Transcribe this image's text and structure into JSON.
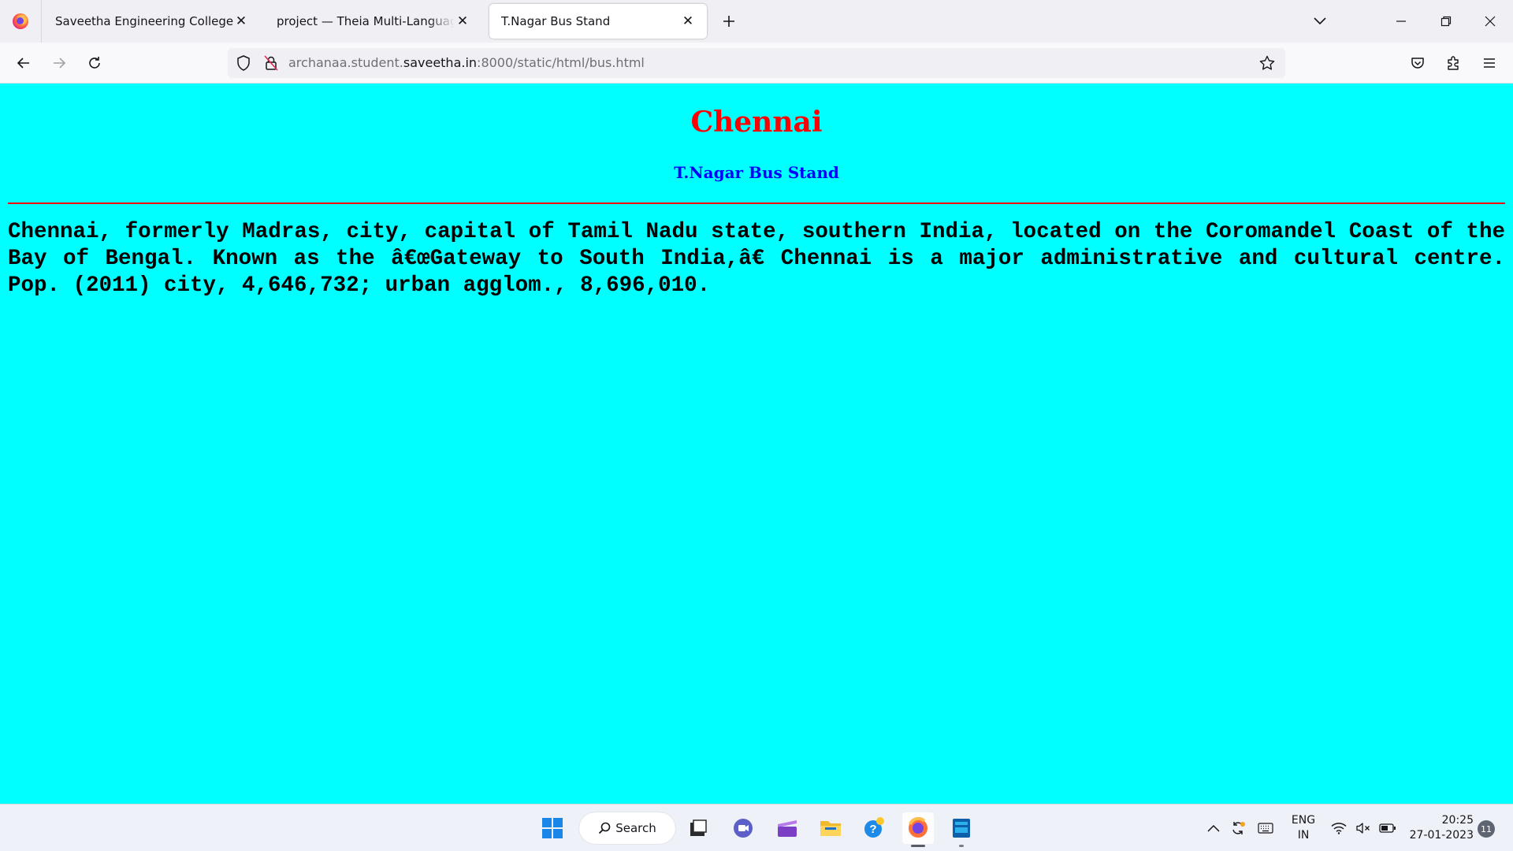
{
  "browser": {
    "tabs": [
      {
        "title": "Saveetha Engineering College",
        "active": false
      },
      {
        "title": "project — Theia Multi-Language Explorer",
        "active": false
      },
      {
        "title": "T.Nagar Bus Stand",
        "active": true
      }
    ],
    "new_tab_icon": "plus-icon",
    "url": {
      "prefix": "archanaa.student.",
      "host": "saveetha.in",
      "suffix": ":8000/static/html/bus.html"
    }
  },
  "page": {
    "background": "#00ffff",
    "heading": "Chennai",
    "heading_color": "#ff0000",
    "subheading": "T.Nagar Bus Stand",
    "subheading_color": "#0000ff",
    "rule_color": "#ff0000",
    "paragraph": "Chennai, formerly Madras, city, capital of Tamil Nadu state, southern India, located on the Coromandel Coast of the Bay of Bengal. Known as the â€œGateway to South India,â€ Chennai is a major administrative and cultural centre. Pop. (2011) city, 4,646,732; urban agglom., 8,696,010."
  },
  "taskbar": {
    "search_label": "Search",
    "language_line1": "ENG",
    "language_line2": "IN",
    "time": "20:25",
    "date": "27-01-2023",
    "notification_count": "11"
  }
}
